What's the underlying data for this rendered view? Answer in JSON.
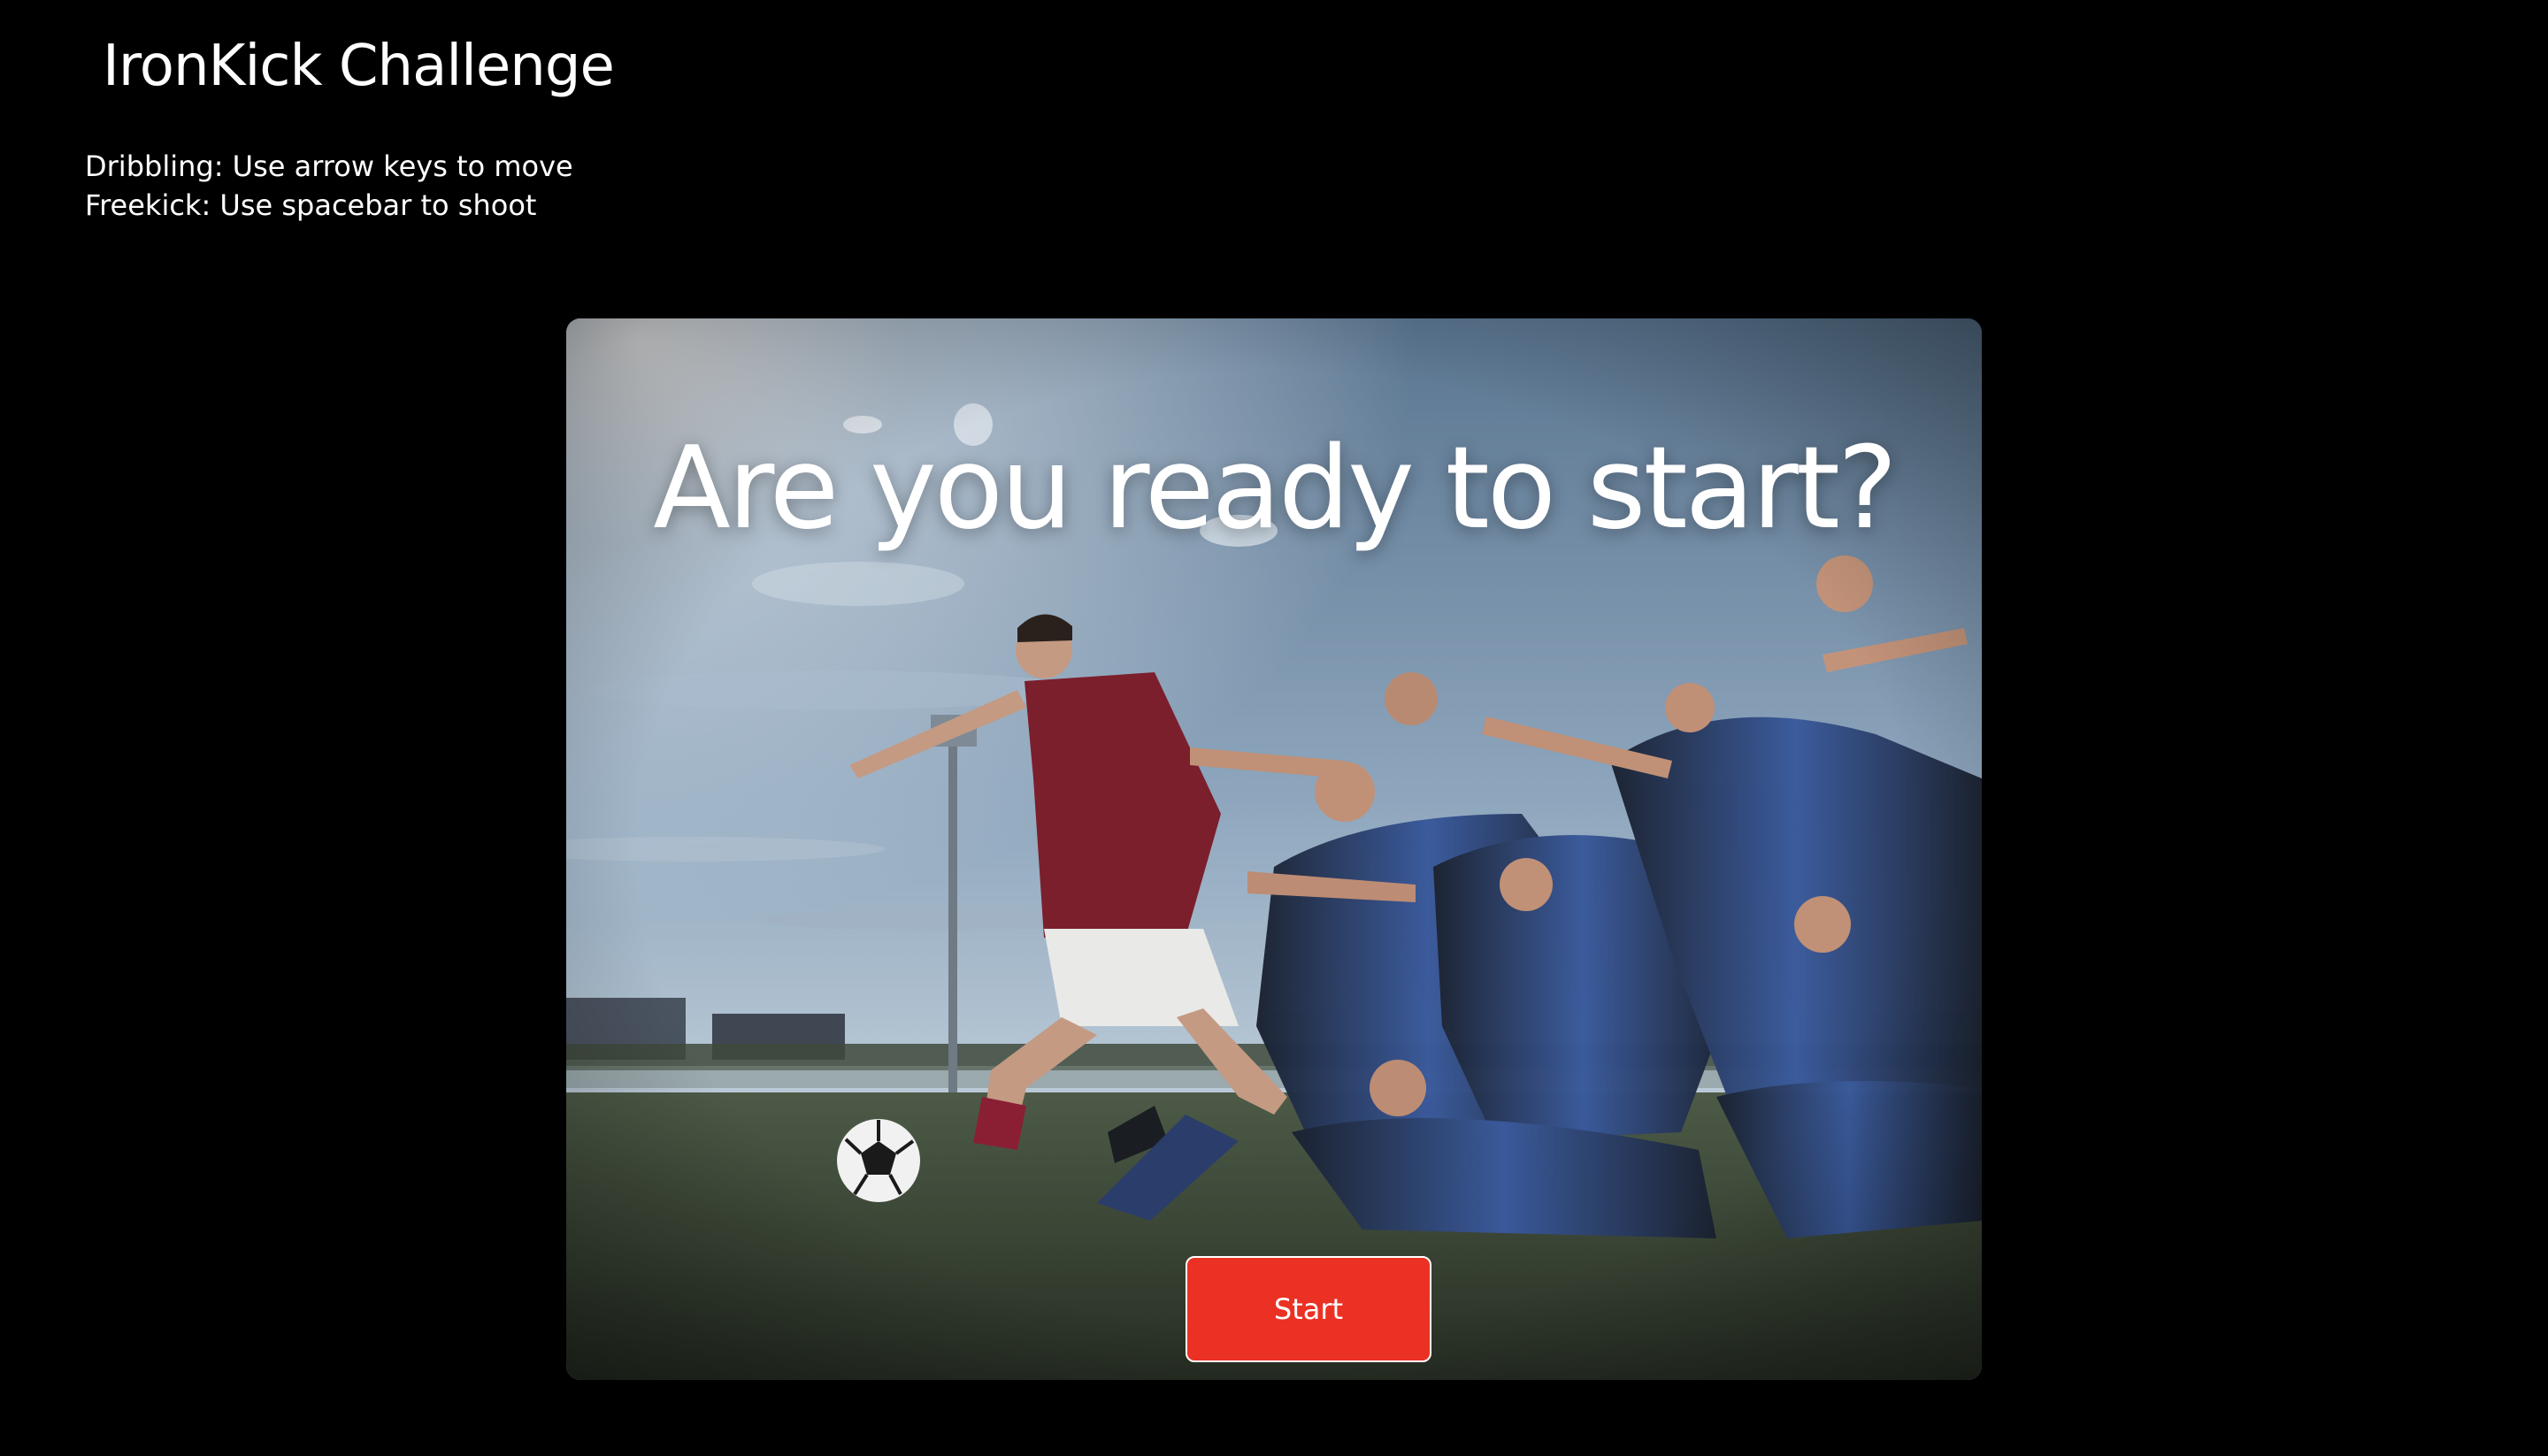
{
  "app": {
    "title": "IronKick Challenge"
  },
  "instructions": {
    "dribbling": "Dribbling: Use arrow keys to move",
    "freekick": "Freekick: Use spacebar to shoot"
  },
  "start_screen": {
    "headline": "Are you ready to start?",
    "start_label": "Start"
  },
  "colors": {
    "background": "#000000",
    "start_button": "#ea3124",
    "text": "#ffffff"
  }
}
